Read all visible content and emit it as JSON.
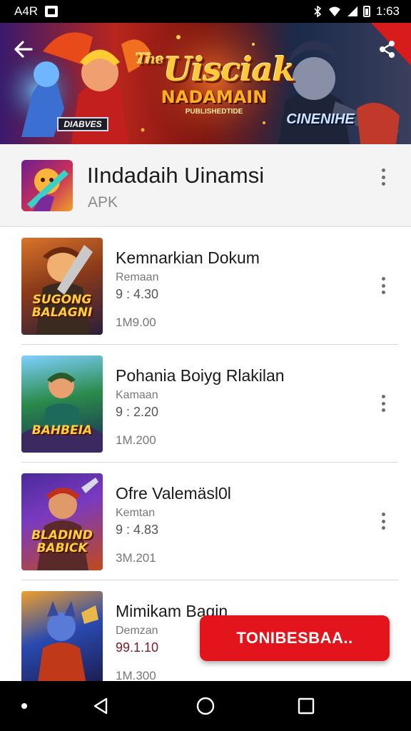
{
  "status_bar": {
    "carrier": "A4R",
    "time": "1:63",
    "icons": [
      "notification-icon",
      "bluetooth-icon",
      "wifi-icon",
      "signal-icon",
      "battery-icon"
    ]
  },
  "banner": {
    "title": "Uisciak",
    "title_prefix": "The",
    "subtitle": "NADAMAIN",
    "subtitle_small": "PUBLISHEDTIDE",
    "left_tag": "DIABVES",
    "right_tag": "CINENIHE",
    "icons": [
      "back-arrow-icon",
      "share-icon"
    ]
  },
  "app": {
    "name": "IIndadaih Uinamsi",
    "type": "APK",
    "icon": "game-app-icon"
  },
  "items": [
    {
      "title": "Kemnarkian Dokum",
      "developer": "Remaan",
      "rating": "9 : 4.30",
      "downloads": "1M9.00",
      "art_label": "SUGONG BALAGNI",
      "colors": [
        "#c6631e",
        "#2a1f3d"
      ]
    },
    {
      "title": "Pohania Boiyg Rlakilan",
      "developer": "Kamaan",
      "rating": "9 : 2.20",
      "downloads": "1M.200",
      "art_label": "BAHBEIA",
      "colors": [
        "#2a8a4a",
        "#1a2a5a"
      ]
    },
    {
      "title": "Ofre Valemäsl0l",
      "developer": "Kemtan",
      "rating": "9 : 4.83",
      "downloads": "3M.201",
      "art_label": "BLADIND BABICK",
      "colors": [
        "#6a2aa0",
        "#c04a1a"
      ]
    },
    {
      "title": "Mimikam Baqin",
      "developer": "Demzan",
      "rating": "99.1.10",
      "downloads": "1M.300",
      "art_label": "",
      "colors": [
        "#2a4ab0",
        "#e06a1a"
      ]
    }
  ],
  "cta": {
    "label": "TONIBESBAA.."
  },
  "nav_bar": {
    "icons": [
      "back-triangle-icon",
      "home-circle-icon",
      "recents-square-icon"
    ]
  }
}
